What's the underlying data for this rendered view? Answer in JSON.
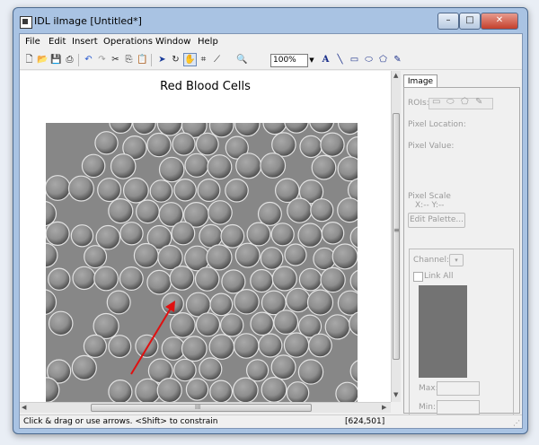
{
  "window": {
    "title": "IDL iImage [Untitled*]",
    "controls": {
      "minimize": "–",
      "maximize": "□",
      "close": "✕"
    }
  },
  "menubar": [
    "File",
    "Edit",
    "Insert",
    "Operations",
    "Window",
    "Help"
  ],
  "toolbar": {
    "zoom_value": "100%",
    "tools": [
      "new-icon",
      "open-icon",
      "save-icon",
      "print-icon",
      "undo-icon",
      "redo-icon",
      "cut-icon",
      "copy-icon",
      "paste-icon",
      "pan-icon",
      "select-arrow-icon",
      "rotate-icon",
      "crop-icon",
      "line-profile-icon",
      "zoom-icon",
      "text-icon",
      "line-icon",
      "rectangle-icon",
      "ellipse-icon",
      "polygon-icon",
      "freehand-icon"
    ]
  },
  "canvas": {
    "title": "Red Blood Cells",
    "image_description_colors": {
      "background": "#8a8a8a",
      "arrow": "#e01010"
    }
  },
  "scroll": {
    "hgrip": "III",
    "vgrip": "≡"
  },
  "panel": {
    "tab": "Image",
    "rois_label": "ROIs:",
    "pixel_location_label": "Pixel Location:",
    "pixel_value_label": "Pixel Value:",
    "pixel_scale_label": "Pixel Scale",
    "pixel_scale_xy": "X:--    Y:--",
    "edit_palette_button": "Edit Palette...",
    "channel_label": "Channel:",
    "link_all_label": "Link All",
    "max_label": "Max:",
    "min_label": "Min:"
  },
  "status": {
    "message": "Click & drag or use arrows. <Shift> to constrain",
    "coordinates": "[624,501]"
  }
}
